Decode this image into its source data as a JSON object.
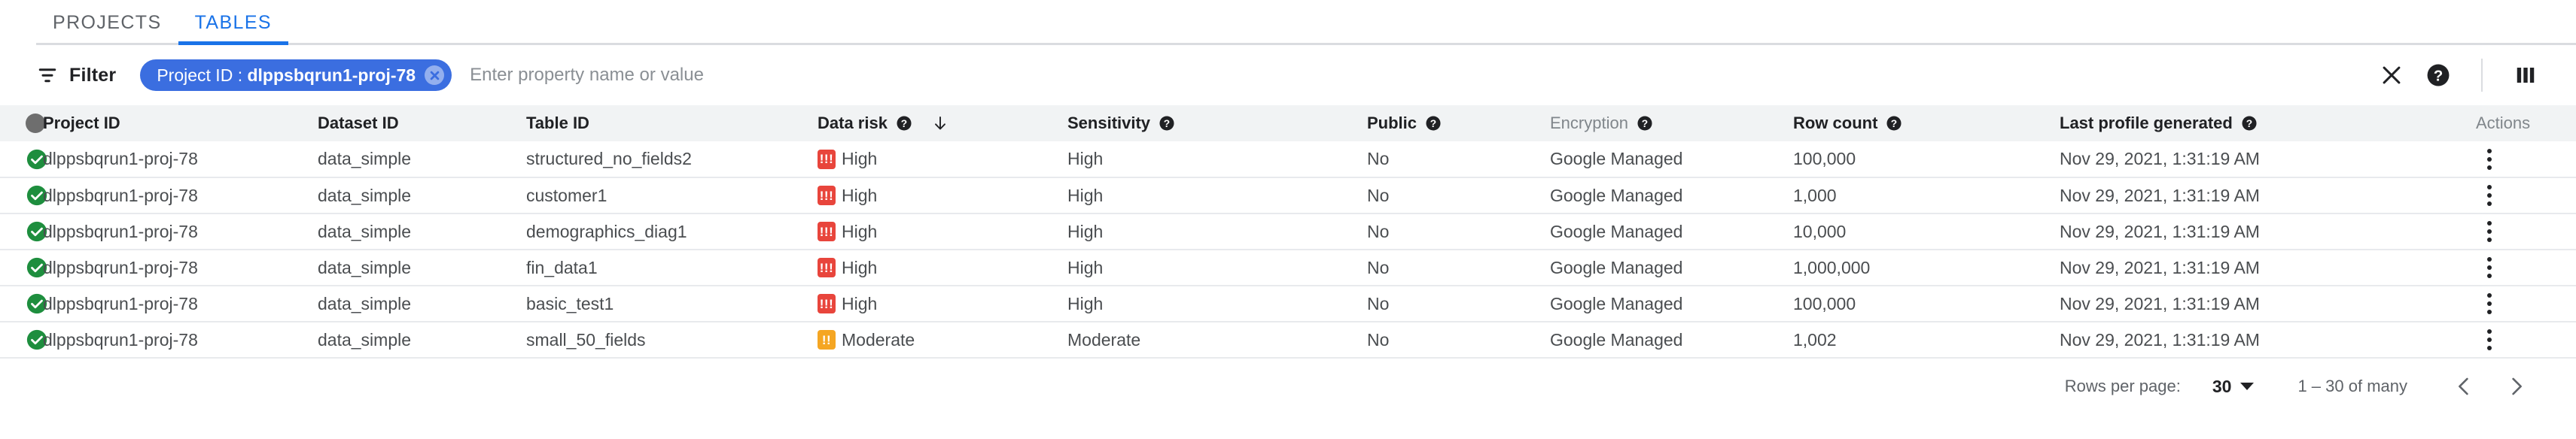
{
  "tabs": [
    {
      "label": "PROJECTS",
      "active": false
    },
    {
      "label": "TABLES",
      "active": true
    }
  ],
  "filter_bar": {
    "filter_label": "Filter",
    "filter_icon": "filter-list-icon",
    "chip": {
      "key": "Project ID",
      "separator": " : ",
      "value": "dlppsbqrun1-proj-78",
      "remove_icon": "chip-remove-icon"
    },
    "input_placeholder": "Enter property name or value",
    "input_value": "",
    "actions": [
      {
        "name": "clear-filter-button",
        "icon": "close-icon"
      },
      {
        "name": "help-button",
        "icon": "help-circle-icon"
      },
      {
        "name": "column-display-button",
        "icon": "column-display-icon"
      }
    ]
  },
  "table": {
    "columns": [
      {
        "label": "",
        "name": "status",
        "help": false,
        "muted": false
      },
      {
        "label": "Project ID",
        "name": "project-id",
        "help": false,
        "muted": false
      },
      {
        "label": "Dataset ID",
        "name": "dataset-id",
        "help": false,
        "muted": false
      },
      {
        "label": "Table ID",
        "name": "table-id",
        "help": false,
        "muted": false
      },
      {
        "label": "Data risk",
        "name": "data-risk",
        "help": true,
        "muted": false,
        "sorted": "desc"
      },
      {
        "label": "Sensitivity",
        "name": "sensitivity",
        "help": true,
        "muted": false
      },
      {
        "label": "Public",
        "name": "public",
        "help": true,
        "muted": false
      },
      {
        "label": "Encryption",
        "name": "encryption",
        "help": true,
        "muted": true
      },
      {
        "label": "Row count",
        "name": "row-count",
        "help": true,
        "muted": false
      },
      {
        "label": "Last profile generated",
        "name": "last-profile-generated",
        "help": true,
        "muted": false
      },
      {
        "label": "Actions",
        "name": "actions",
        "help": false,
        "muted": true
      }
    ],
    "rows": [
      {
        "status": "ok",
        "project_id": "dlppsbqrun1-proj-78",
        "dataset_id": "data_simple",
        "table_id": "structured_no_fields2",
        "data_risk": "High",
        "data_risk_level": "high",
        "sensitivity": "High",
        "public": "No",
        "encryption": "Google Managed",
        "row_count": "100,000",
        "last_profile_generated": "Nov 29, 2021, 1:31:19 AM"
      },
      {
        "status": "ok",
        "project_id": "dlppsbqrun1-proj-78",
        "dataset_id": "data_simple",
        "table_id": "customer1",
        "data_risk": "High",
        "data_risk_level": "high",
        "sensitivity": "High",
        "public": "No",
        "encryption": "Google Managed",
        "row_count": "1,000",
        "last_profile_generated": "Nov 29, 2021, 1:31:19 AM"
      },
      {
        "status": "ok",
        "project_id": "dlppsbqrun1-proj-78",
        "dataset_id": "data_simple",
        "table_id": "demographics_diag1",
        "data_risk": "High",
        "data_risk_level": "high",
        "sensitivity": "High",
        "public": "No",
        "encryption": "Google Managed",
        "row_count": "10,000",
        "last_profile_generated": "Nov 29, 2021, 1:31:19 AM"
      },
      {
        "status": "ok",
        "project_id": "dlppsbqrun1-proj-78",
        "dataset_id": "data_simple",
        "table_id": "fin_data1",
        "data_risk": "High",
        "data_risk_level": "high",
        "sensitivity": "High",
        "public": "No",
        "encryption": "Google Managed",
        "row_count": "1,000,000",
        "last_profile_generated": "Nov 29, 2021, 1:31:19 AM"
      },
      {
        "status": "ok",
        "project_id": "dlppsbqrun1-proj-78",
        "dataset_id": "data_simple",
        "table_id": "basic_test1",
        "data_risk": "High",
        "data_risk_level": "high",
        "sensitivity": "High",
        "public": "No",
        "encryption": "Google Managed",
        "row_count": "100,000",
        "last_profile_generated": "Nov 29, 2021, 1:31:19 AM"
      },
      {
        "status": "ok",
        "project_id": "dlppsbqrun1-proj-78",
        "dataset_id": "data_simple",
        "table_id": "small_50_fields",
        "data_risk": "Moderate",
        "data_risk_level": "moderate",
        "sensitivity": "Moderate",
        "public": "No",
        "encryption": "Google Managed",
        "row_count": "1,002",
        "last_profile_generated": "Nov 29, 2021, 1:31:19 AM"
      }
    ]
  },
  "footer": {
    "rows_per_page_label": "Rows per page:",
    "rows_per_page_value": "30",
    "range_text": "1 – 30 of many",
    "prev_icon": "chevron-left-icon",
    "next_icon": "chevron-right-icon"
  },
  "colors": {
    "accent": "#1a73e8",
    "chip": "#3b6ee0",
    "status_ok": "#1e8e3e",
    "risk_high": "#e8453c",
    "risk_moderate": "#f5a623",
    "header_bg": "#f1f3f4"
  },
  "risk_badge_glyphs": {
    "high": "!!!",
    "moderate": "!!"
  }
}
